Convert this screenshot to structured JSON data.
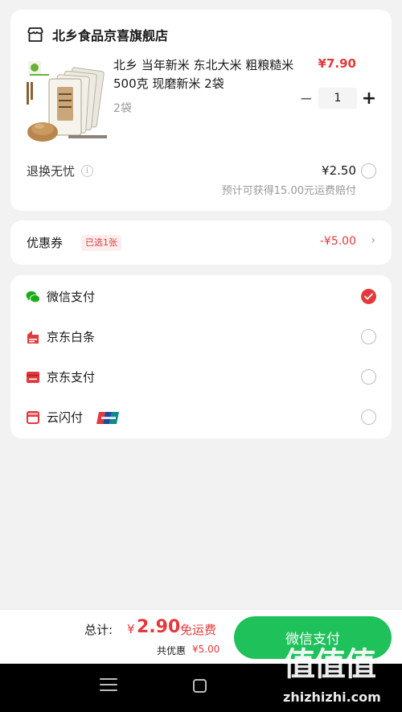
{
  "store": {
    "name": "北乡食品京喜旗舰店",
    "icon": "store-icon"
  },
  "product": {
    "title": "北乡 当年新米 东北大米 粗粮糙米500克  现磨新米 2袋",
    "spec": "2袋",
    "price": "¥7.90",
    "quantity": "1",
    "minus": "−",
    "plus": "+",
    "image_icon": "rice-bag-image"
  },
  "service": {
    "label": "退换无忧",
    "info_icon": "i",
    "price": "¥2.50",
    "note": "预计可获得15.00元运费赔付",
    "selected": false
  },
  "coupon": {
    "label": "优惠券",
    "badge": "已选1张",
    "amount": "-¥5.00",
    "chevron": "›"
  },
  "payment": {
    "methods": [
      {
        "label": "微信支付",
        "icon": "wechat-pay-icon",
        "color": "#1aad19",
        "selected": true
      },
      {
        "label": "京东白条",
        "icon": "jd-baitiao-icon",
        "color": "#e4393c",
        "selected": false
      },
      {
        "label": "京东支付",
        "icon": "jd-pay-icon",
        "color": "#e4393c",
        "selected": false
      },
      {
        "label": "云闪付",
        "icon": "quickpass-icon",
        "color": "#e4393c",
        "selected": false
      }
    ]
  },
  "footer": {
    "total_label": "总计:",
    "currency": "¥",
    "total_amount": "2.90",
    "shipping": "免运费",
    "discount_label": "共优惠",
    "discount_amount": "¥5.00",
    "pay_button": "微信支付"
  },
  "watermark": {
    "logo": "值值值",
    "text": "zhizhizhi.com"
  },
  "colors": {
    "accent_red": "#e4393c",
    "wechat_green": "#1fc15a",
    "background": "#f2f2f2"
  }
}
